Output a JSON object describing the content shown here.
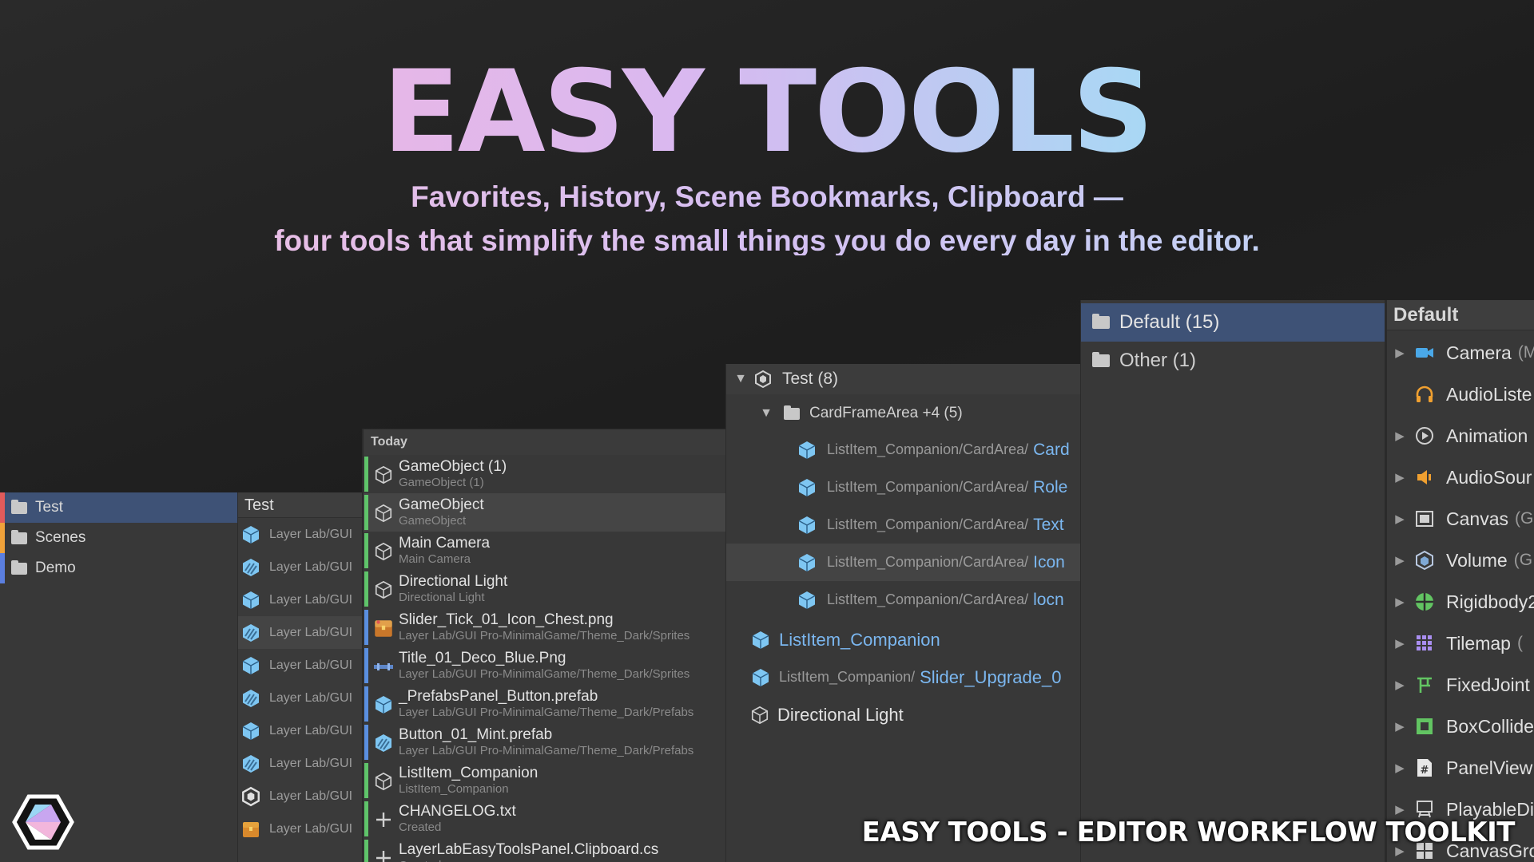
{
  "hero": {
    "title": "EASY TOOLS",
    "subtitle_line1": "Favorites, History, Scene Bookmarks, Clipboard —",
    "subtitle_line2": "four tools that simplify the small things you do every day in the editor."
  },
  "favorites_panel": {
    "items": [
      {
        "label": "Test",
        "color": "#e15b5b",
        "selected": true
      },
      {
        "label": "Scenes",
        "color": "#f0a23a",
        "selected": false
      },
      {
        "label": "Demo",
        "color": "#5b7fe0",
        "selected": false
      }
    ]
  },
  "favorites_list": {
    "header": "Test",
    "items": [
      "Layer Lab/GUI",
      "Layer Lab/GUI",
      "Layer Lab/GUI",
      "Layer Lab/GUI",
      "Layer Lab/GUI",
      "Layer Lab/GUI",
      "Layer Lab/GUI",
      "Layer Lab/GUI",
      "Layer Lab/GUI",
      "Layer Lab/GUI"
    ]
  },
  "history_panel": {
    "header": "Today",
    "items": [
      {
        "name": "GameObject (1)",
        "path": "GameObject (1)",
        "bar": "#5fc46a",
        "icon": "gameobject-icon"
      },
      {
        "name": "GameObject",
        "path": "GameObject",
        "bar": "#5fc46a",
        "icon": "gameobject-icon"
      },
      {
        "name": "Main Camera",
        "path": "Main Camera",
        "bar": "#5fc46a",
        "icon": "gameobject-icon"
      },
      {
        "name": "Directional Light",
        "path": "Directional Light",
        "bar": "#5fc46a",
        "icon": "gameobject-icon"
      },
      {
        "name": "Slider_Tick_01_Icon_Chest.png",
        "path": "Layer Lab/GUI Pro-MinimalGame/Theme_Dark/Sprites",
        "bar": "#5a8fe0",
        "icon": "chest-icon"
      },
      {
        "name": "Title_01_Deco_Blue.Png",
        "path": "Layer Lab/GUI Pro-MinimalGame/Theme_Dark/Sprites",
        "bar": "#5a8fe0",
        "icon": "sprite-icon"
      },
      {
        "name": "_PrefabsPanel_Button.prefab",
        "path": "Layer Lab/GUI Pro-MinimalGame/Theme_Dark/Prefabs",
        "bar": "#5a8fe0",
        "icon": "prefab-icon"
      },
      {
        "name": "Button_01_Mint.prefab",
        "path": "Layer Lab/GUI Pro-MinimalGame/Theme_Dark/Prefabs",
        "bar": "#5a8fe0",
        "icon": "prefab-variant-icon"
      },
      {
        "name": "ListItem_Companion",
        "path": "ListItem_Companion",
        "bar": "#5fc46a",
        "icon": "gameobject-icon"
      },
      {
        "name": "CHANGELOG.txt",
        "path": "Created",
        "bar": "#5fc46a",
        "icon": "plus-icon"
      },
      {
        "name": "LayerLabEasyToolsPanel.Clipboard.cs",
        "path": "Created",
        "bar": "#5fc46a",
        "icon": "plus-icon"
      }
    ]
  },
  "bookmarks_panel": {
    "root": "Test (8)",
    "group": "CardFrameArea +4 (5)",
    "children": [
      {
        "path": "ListItem_Companion/CardArea/",
        "name": "Card"
      },
      {
        "path": "ListItem_Companion/CardArea/",
        "name": "Role"
      },
      {
        "path": "ListItem_Companion/CardArea/",
        "name": "Text"
      },
      {
        "path": "ListItem_Companion/CardArea/",
        "name": "Icon"
      },
      {
        "path": "ListItem_Companion/CardArea/",
        "name": "locn"
      }
    ],
    "items": [
      {
        "path": "",
        "name": "ListItem_Companion"
      },
      {
        "path": "ListItem_Companion/",
        "name": "Slider_Upgrade_0"
      },
      {
        "path": "",
        "name": "Directional Light"
      }
    ]
  },
  "clipboard_groups": {
    "items": [
      {
        "label": "Default (15)",
        "selected": true
      },
      {
        "label": "Other (1)",
        "selected": false
      }
    ]
  },
  "components_panel": {
    "header": "Default",
    "items": [
      {
        "label": "Camera",
        "suffix": "(M",
        "icon": "camera-icon",
        "arrow": true
      },
      {
        "label": "AudioListe",
        "suffix": "",
        "icon": "headphones-icon",
        "arrow": false
      },
      {
        "label": "Animation",
        "suffix": "",
        "icon": "animation-icon",
        "arrow": true
      },
      {
        "label": "AudioSour",
        "suffix": "",
        "icon": "speaker-icon",
        "arrow": true
      },
      {
        "label": "Canvas",
        "suffix": "(G",
        "icon": "canvas-icon",
        "arrow": true
      },
      {
        "label": "Volume",
        "suffix": "(G",
        "icon": "volume-icon",
        "arrow": true
      },
      {
        "label": "Rigidbody2",
        "suffix": "",
        "icon": "rigidbody-icon",
        "arrow": true
      },
      {
        "label": "Tilemap",
        "suffix": "(",
        "icon": "tilemap-icon",
        "arrow": true
      },
      {
        "label": "FixedJoint",
        "suffix": "",
        "icon": "joint-icon",
        "arrow": true
      },
      {
        "label": "BoxCollide",
        "suffix": "",
        "icon": "boxcollider-icon",
        "arrow": true
      },
      {
        "label": "PanelView",
        "suffix": "",
        "icon": "script-icon",
        "arrow": true
      },
      {
        "label": "PlayableDi",
        "suffix": "",
        "icon": "playable-icon",
        "arrow": true
      },
      {
        "label": "CanvasGro",
        "suffix": "",
        "icon": "canvasgroup-icon",
        "arrow": true
      }
    ]
  },
  "footer": {
    "tagline": "EASY TOOLS - EDITOR WORKFLOW TOOLKIT"
  }
}
